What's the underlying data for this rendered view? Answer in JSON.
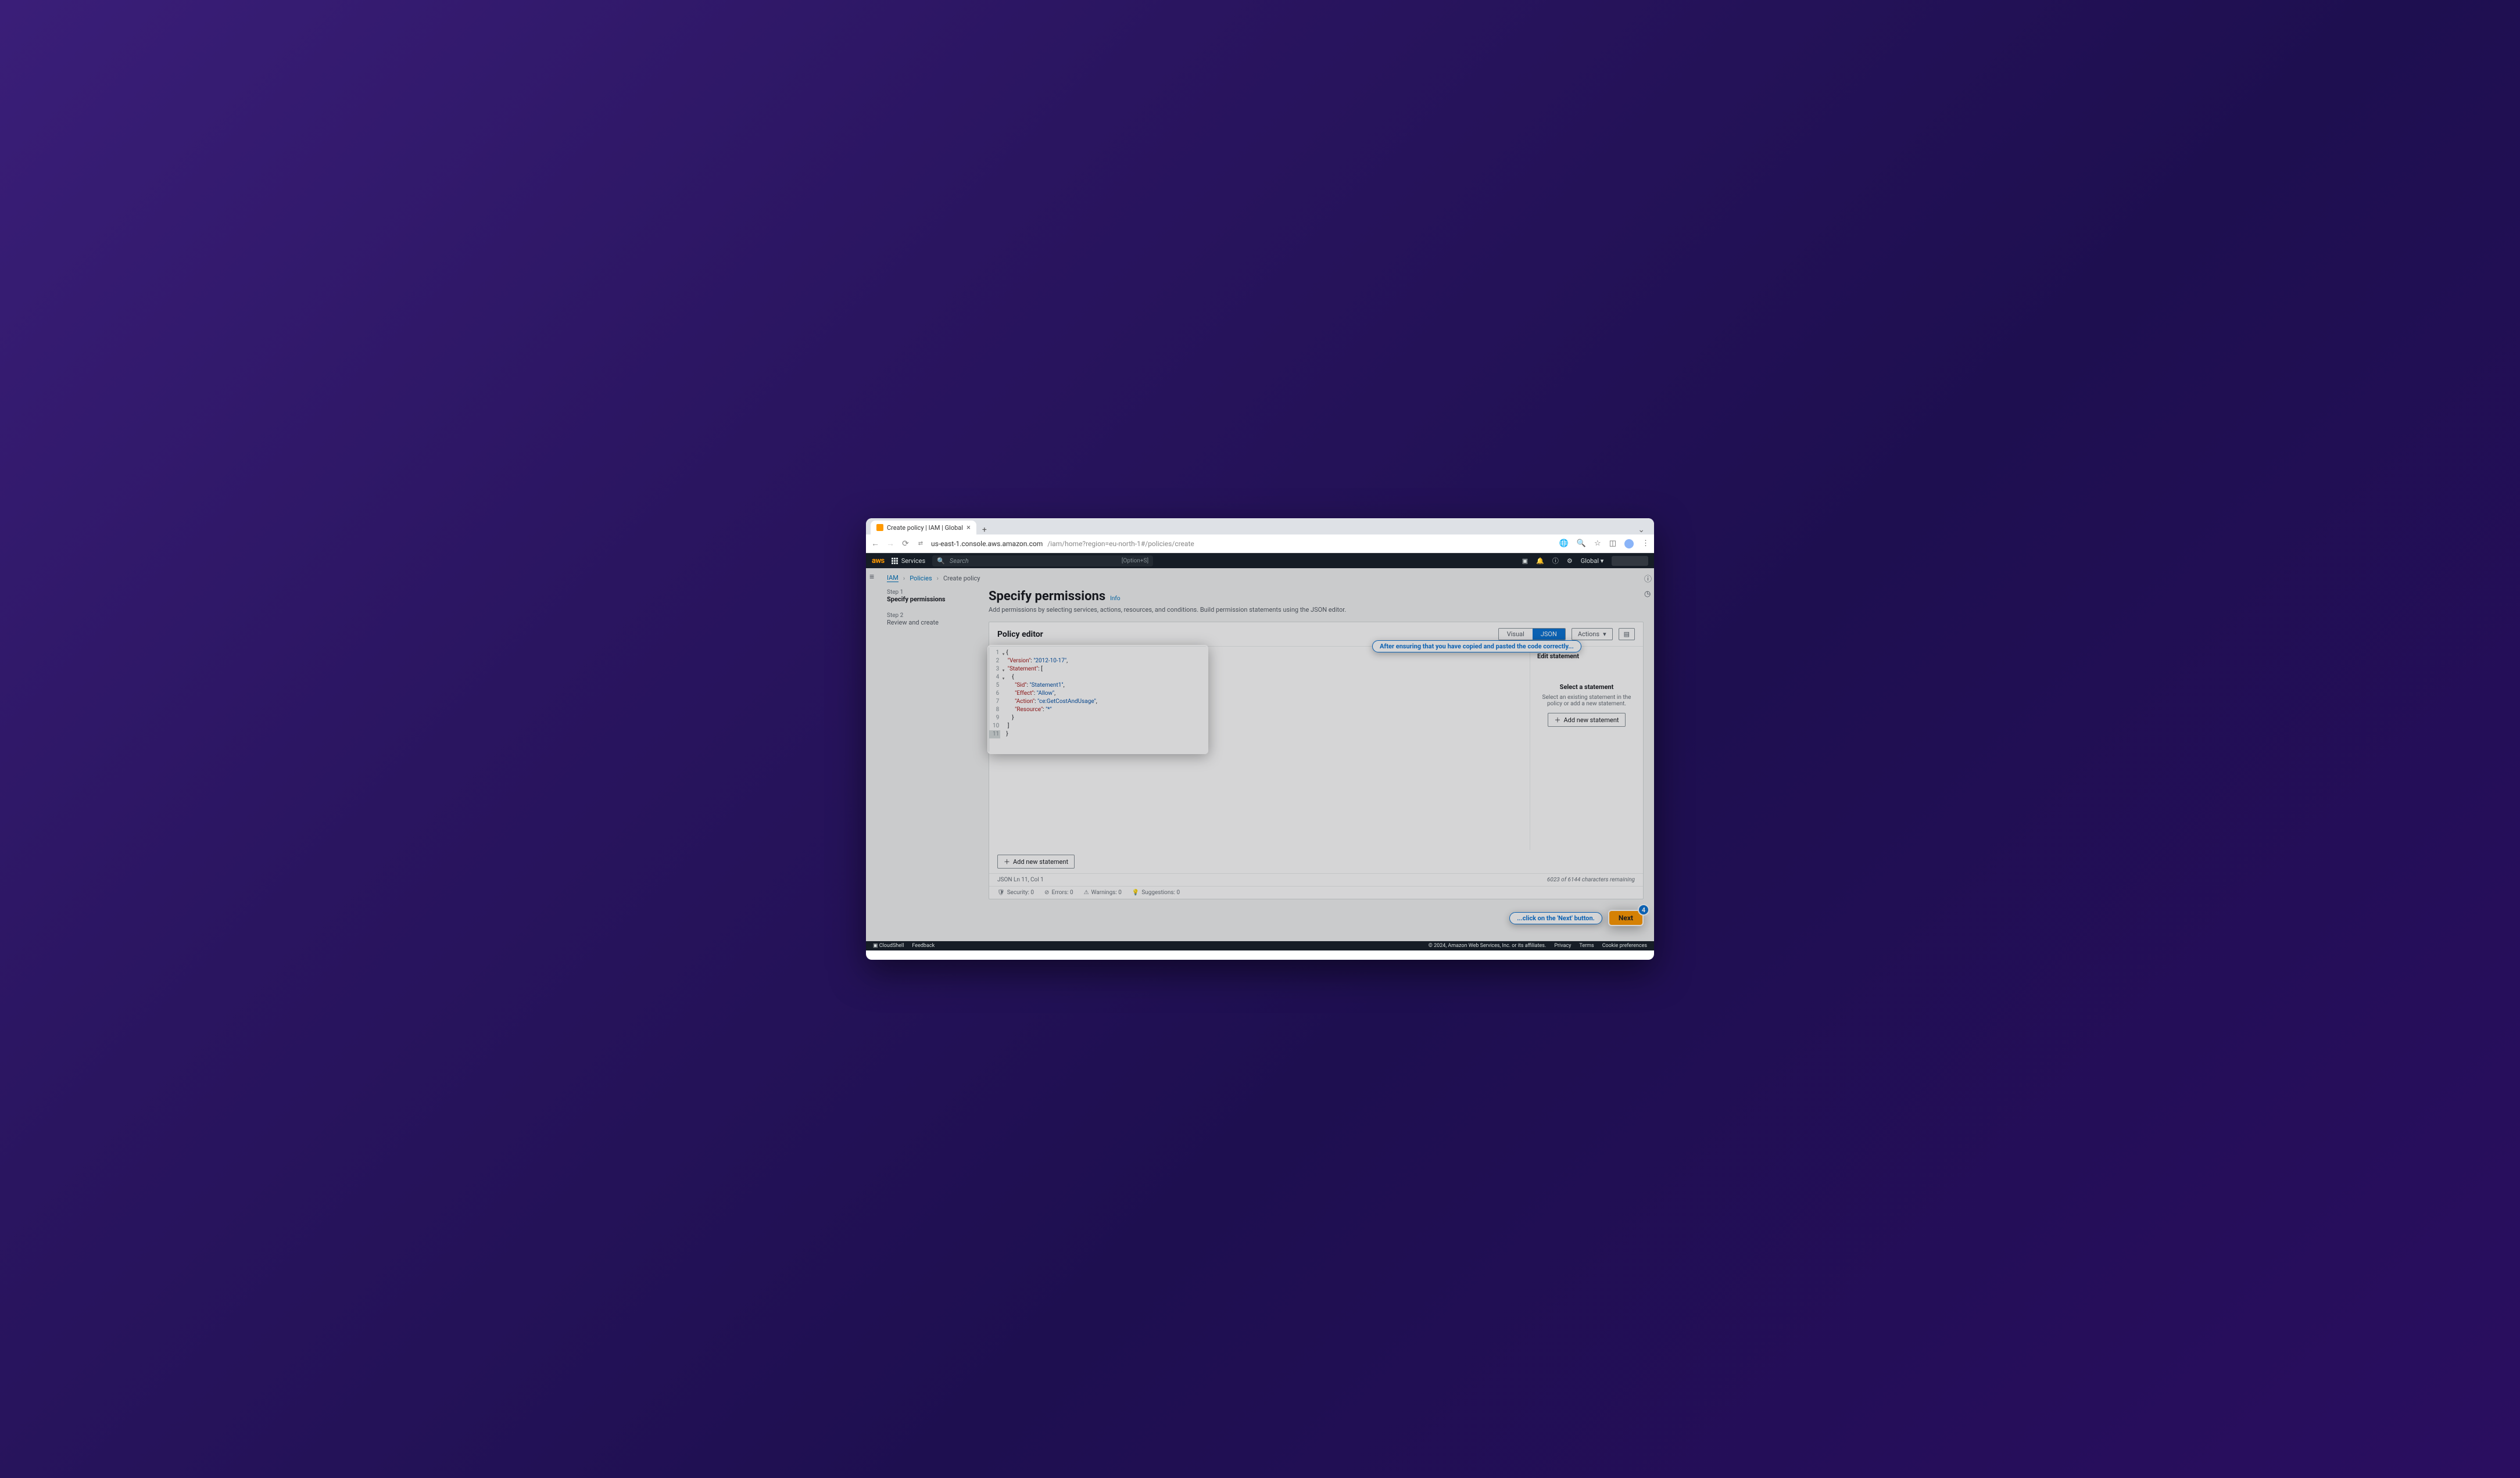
{
  "browser": {
    "tab_title": "Create policy | IAM | Global",
    "url_host": "us-east-1.console.aws.amazon.com",
    "url_path": "/iam/home?region=eu-north-1#/policies/create"
  },
  "aws_bar": {
    "logo": "aws",
    "services": "Services",
    "search_placeholder": "Search",
    "search_hint": "[Option+S]",
    "region": "Global"
  },
  "breadcrumb": {
    "iam": "IAM",
    "policies": "Policies",
    "create": "Create policy"
  },
  "wizard": {
    "step1_num": "Step 1",
    "step1_label": "Specify permissions",
    "step2_num": "Step 2",
    "step2_label": "Review and create"
  },
  "page": {
    "title": "Specify permissions",
    "info": "Info",
    "subtitle": "Add permissions by selecting services, actions, resources, and conditions. Build permission statements using the JSON editor."
  },
  "editor": {
    "title": "Policy editor",
    "visual": "Visual",
    "json": "JSON",
    "actions": "Actions",
    "add_stmt": "Add new statement",
    "status_left": "JSON   Ln 11, Col 1",
    "status_right": "6023 of 6144 characters remaining",
    "sec": "Security: 0",
    "err": "Errors: 0",
    "warn": "Warnings: 0",
    "sugg": "Suggestions: 0"
  },
  "code": {
    "lines": [
      "1",
      "2",
      "3",
      "4",
      "5",
      "6",
      "7",
      "8",
      "9",
      "10",
      "11"
    ],
    "l1": "{",
    "l2a": "\"Version\"",
    "l2b": ": ",
    "l2c": "\"2012-10-17\"",
    "l2d": ",",
    "l3a": "\"Statement\"",
    "l3b": ": [",
    "l4": "    {",
    "l5a": "\"Sid\"",
    "l5b": ": ",
    "l5c": "\"Statement1\"",
    "l5d": ",",
    "l6a": "\"Effect\"",
    "l6b": ": ",
    "l6c": "\"Allow\"",
    "l6d": ",",
    "l7a": "\"Action\"",
    "l7b": ": ",
    "l7c": "\"ce:GetCostAndUsage\"",
    "l7d": ",",
    "l8a": "\"Resource\"",
    "l8b": ": ",
    "l8c": "\"*\"",
    "l9": "    }",
    "l10": "]",
    "l11": "}"
  },
  "panel": {
    "title": "Edit statement",
    "select_title": "Select a statement",
    "select_sub": "Select an existing statement in the policy or add a new statement.",
    "add": "Add new statement"
  },
  "callouts": {
    "editor": "After ensuring that you have copied and pasted the code correctly...",
    "next": "...click on the 'Next' button.",
    "step_num": "4"
  },
  "next_btn": "Next",
  "footer": {
    "cloudshell": "CloudShell",
    "feedback": "Feedback",
    "copyright": "© 2024, Amazon Web Services, Inc. or its affiliates.",
    "privacy": "Privacy",
    "terms": "Terms",
    "cookies": "Cookie preferences"
  }
}
